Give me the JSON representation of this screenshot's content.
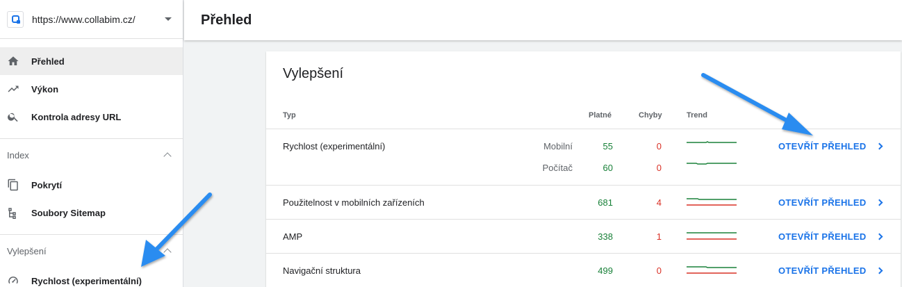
{
  "property": {
    "url": "https://www.collabim.cz/"
  },
  "nav": {
    "overview": "Přehled",
    "performance": "Výkon",
    "url_inspection": "Kontrola adresy URL",
    "index_header": "Index",
    "coverage": "Pokrytí",
    "sitemaps": "Soubory Sitemap",
    "enhancements_header": "Vylepšení",
    "speed": "Rychlost (experimentální)"
  },
  "header": {
    "title": "Přehled"
  },
  "card": {
    "title": "Vylepšení",
    "columns": {
      "type": "Typ",
      "valid": "Platné",
      "errors": "Chyby",
      "trend": "Trend"
    },
    "rows": [
      {
        "type": "Rychlost (experimentální)",
        "sub": [
          {
            "device": "Mobilní",
            "valid": "55",
            "errors": "0"
          },
          {
            "device": "Počítač",
            "valid": "60",
            "errors": "0"
          }
        ],
        "action": "OTEVŘÍT PŘEHLED"
      },
      {
        "type": "Použitelnost v mobilních zařízeních",
        "valid": "681",
        "errors": "4",
        "action": "OTEVŘÍT PŘEHLED"
      },
      {
        "type": "AMP",
        "valid": "338",
        "errors": "1",
        "action": "OTEVŘÍT PŘEHLED"
      },
      {
        "type": "Navigační struktura",
        "valid": "499",
        "errors": "0",
        "action": "OTEVŘÍT PŘEHLED"
      }
    ]
  },
  "colors": {
    "accent": "#1a73e8",
    "valid": "#188038",
    "error": "#d93025",
    "arrow": "#2a8cf0"
  }
}
